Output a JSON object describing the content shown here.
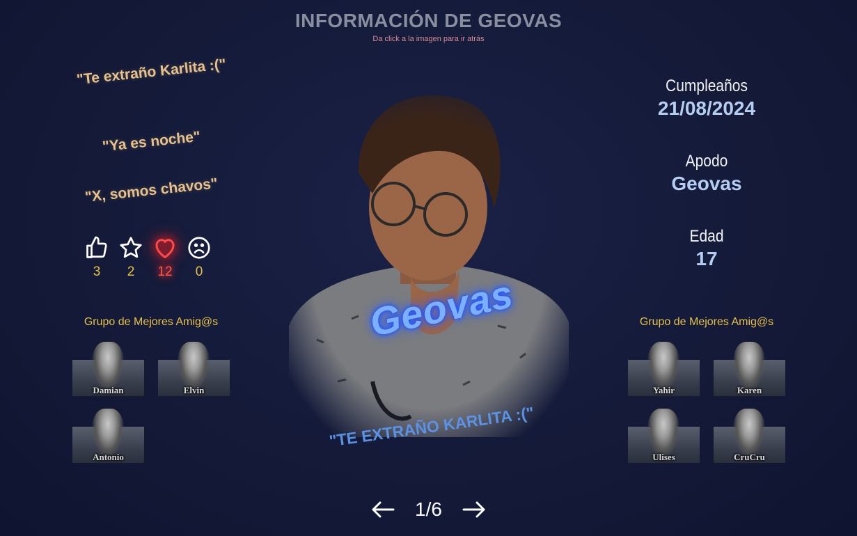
{
  "header": {
    "title": "INFORMACIÓN DE GEOVAS",
    "subtitle": "Da click a la imagen para ir atrás"
  },
  "quotes": [
    "\"Te extraño Karlita :(\"",
    "\"Ya es noche\"",
    "\"X, somos chavos\""
  ],
  "reactions": [
    {
      "icon": "thumbs-up-icon",
      "count": "3",
      "active": false
    },
    {
      "icon": "star-icon",
      "count": "2",
      "active": false
    },
    {
      "icon": "heart-icon",
      "count": "12",
      "active": true
    },
    {
      "icon": "sad-face-icon",
      "count": "0",
      "active": false
    }
  ],
  "friends_left": {
    "title": "Grupo de Mejores Amig@s",
    "members": [
      "Damian",
      "Elvin",
      "Antonio"
    ]
  },
  "friends_right": {
    "title": "Grupo de Mejores Amig@s",
    "members": [
      "Yahir",
      "Karen",
      "Ulises",
      "CruCru"
    ]
  },
  "profile": {
    "nickname_overlay": "Geovas",
    "caption": "\"TE EXTRAÑO KARLITA :(\""
  },
  "info": {
    "birthday_label": "Cumpleaños",
    "birthday_value": "21/08/2024",
    "nickname_label": "Apodo",
    "nickname_value": "Geovas",
    "age_label": "Edad",
    "age_value": "17"
  },
  "pager": {
    "current": "1/6"
  },
  "colors": {
    "background": "#141a38",
    "quote": "#e8c08a",
    "gold": "#e6c04a",
    "heart_active": "#ff3030",
    "info_value": "#b5cdf2",
    "caption": "#5b92e6"
  }
}
